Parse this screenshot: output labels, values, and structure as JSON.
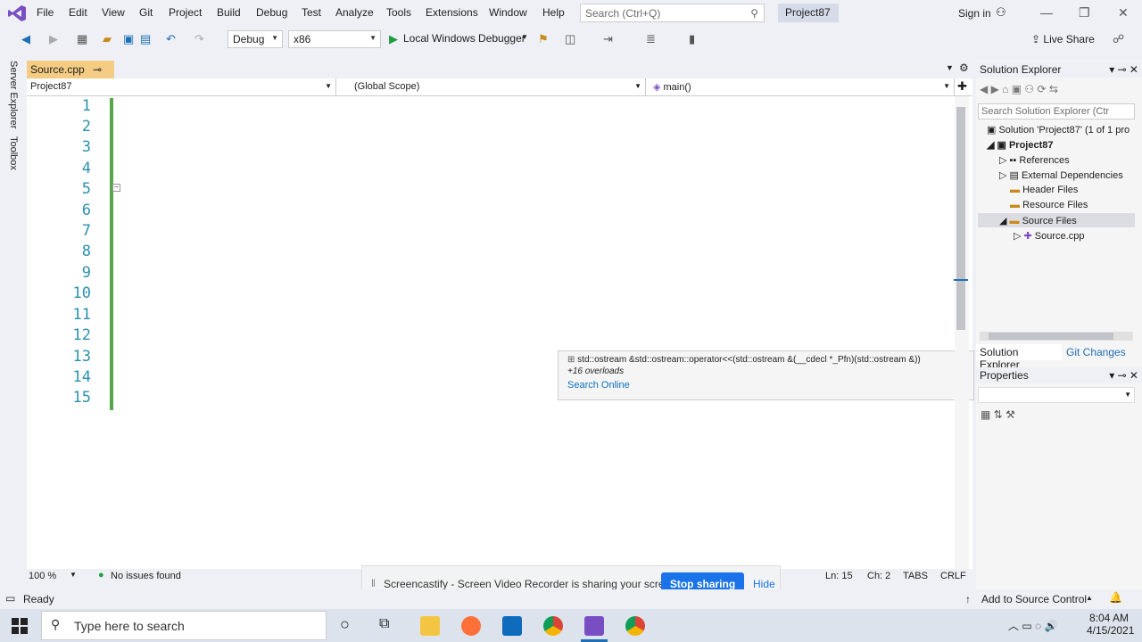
{
  "menu": {
    "items": [
      "File",
      "Edit",
      "View",
      "Git",
      "Project",
      "Build",
      "Debug",
      "Test",
      "Analyze",
      "Tools",
      "Extensions",
      "Window",
      "Help"
    ],
    "search_placeholder": "Search (Ctrl+Q)",
    "project": "Project87",
    "signin": "Sign in"
  },
  "toolbar": {
    "config": "Debug",
    "platform": "x86",
    "run": "Local Windows Debugger",
    "liveshare": "Live Share"
  },
  "left_sidebar": {
    "server_explorer": "Server Explorer",
    "toolbox": "Toolbox"
  },
  "tab": {
    "label": "Source.cpp"
  },
  "navbar": {
    "project": "Project87",
    "scope": "(Global Scope)",
    "member": "main()"
  },
  "code": {
    "lines": [
      "1",
      "2",
      "3",
      "4",
      "5",
      "6",
      "7",
      "8",
      "9",
      "10",
      "11",
      "12",
      "13",
      "14",
      "15"
    ]
  },
  "tooltip": {
    "signature": "std::ostream &std::ostream::operator<<(std::ostream &(__cdecl *_Pfn)(std::ostream &))",
    "overloads": "+16 overloads",
    "search": "Search Online"
  },
  "editor_status": {
    "zoom": "100 %",
    "issues": "No issues found",
    "ln": "Ln: 15",
    "ch": "Ch: 2",
    "tabs": "TABS",
    "crlf": "CRLF"
  },
  "notification": {
    "text": "Screencastify - Screen Video Recorder is sharing your screen.",
    "stop": "Stop sharing",
    "hide": "Hide"
  },
  "status": {
    "ready": "Ready",
    "source_control": "Add to Source Control"
  },
  "solution_explorer": {
    "title": "Solution Explorer",
    "search": "Search Solution Explorer (Ctr",
    "solution": "Solution 'Project87' (1 of 1 pro",
    "project": "Project87",
    "items": [
      "References",
      "External Dependencies",
      "Header Files",
      "Resource Files",
      "Source Files",
      "Source.cpp"
    ],
    "tab1": "Solution Explorer",
    "tab2": "Git Changes"
  },
  "properties": {
    "title": "Properties"
  },
  "taskbar": {
    "search": "Type here to search",
    "time": "8:04 AM",
    "date": "4/15/2021"
  }
}
